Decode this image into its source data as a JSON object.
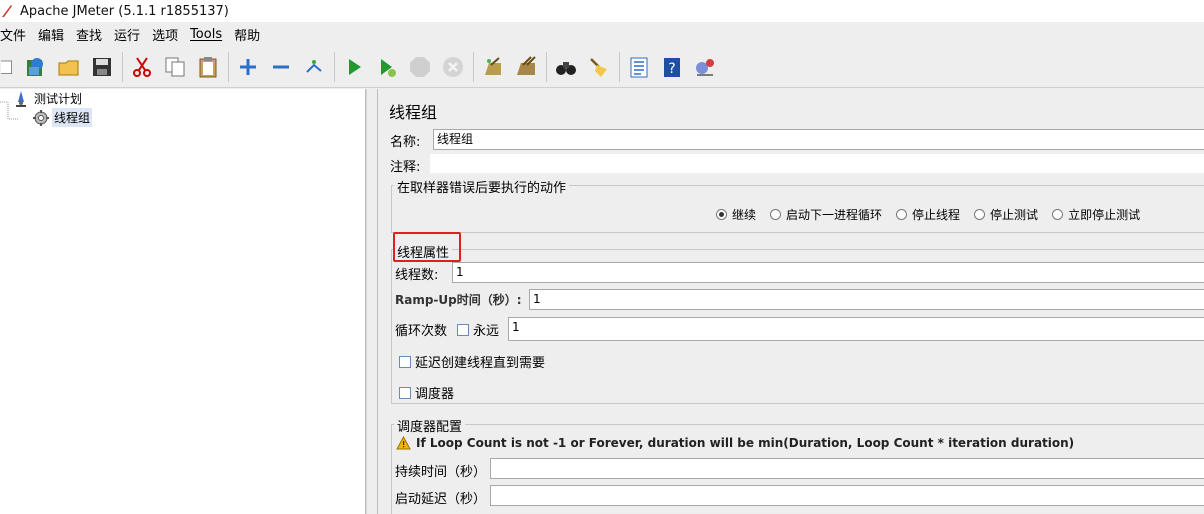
{
  "window": {
    "title": "Apache JMeter (5.1.1 r1855137)"
  },
  "menu": [
    "文件",
    "编辑",
    "查找",
    "运行",
    "选项",
    "Tools",
    "帮助"
  ],
  "toolbar": {
    "buttons": [
      {
        "name": "new-icon"
      },
      {
        "name": "templates-icon"
      },
      {
        "name": "open-icon"
      },
      {
        "name": "save-icon"
      },
      {
        "name": "cut-icon"
      },
      {
        "name": "copy-icon"
      },
      {
        "name": "paste-icon"
      },
      {
        "name": "expand-icon"
      },
      {
        "name": "collapse-icon"
      },
      {
        "name": "toggle-icon"
      },
      {
        "name": "start-icon"
      },
      {
        "name": "start-no-pause-icon"
      },
      {
        "name": "stop-icon"
      },
      {
        "name": "shutdown-icon"
      },
      {
        "name": "clear-icon"
      },
      {
        "name": "clear-all-icon"
      },
      {
        "name": "search-icon"
      },
      {
        "name": "reset-search-icon"
      },
      {
        "name": "function-helper-icon"
      },
      {
        "name": "help-icon"
      },
      {
        "name": "remote-icon"
      }
    ]
  },
  "tree": {
    "items": [
      {
        "label": "测试计划",
        "icon": "test-plan-icon"
      },
      {
        "label": "线程组",
        "icon": "gear-icon",
        "selected": true
      }
    ]
  },
  "panel": {
    "title": "线程组",
    "name_label": "名称:",
    "name_value": "线程组",
    "comment_label": "注释:",
    "comment_value": "",
    "error_action": {
      "title": "在取样器错误后要执行的动作",
      "options": [
        "继续",
        "启动下一进程循环",
        "停止线程",
        "停止测试",
        "立即停止测试"
      ],
      "selected": "继续"
    },
    "thread_props": {
      "title": "线程属性",
      "threads_label": "线程数:",
      "threads_value": "1",
      "rampup_label": "Ramp-Up时间（秒）:",
      "rampup_value": "1",
      "loop_label": "循环次数",
      "forever_label": "永远",
      "loop_value": "1",
      "delay_label": "延迟创建线程直到需要",
      "scheduler_label": "调度器"
    },
    "scheduler_config": {
      "title": "调度器配置",
      "warning": "If Loop Count is not -1 or Forever, duration will be min(Duration, Loop Count * iteration duration)",
      "duration_label": "持续时间（秒）",
      "startup_delay_label": "启动延迟（秒）"
    }
  },
  "colors": {
    "highlight": "#e02020",
    "tree_selection": "#dce6f4"
  }
}
